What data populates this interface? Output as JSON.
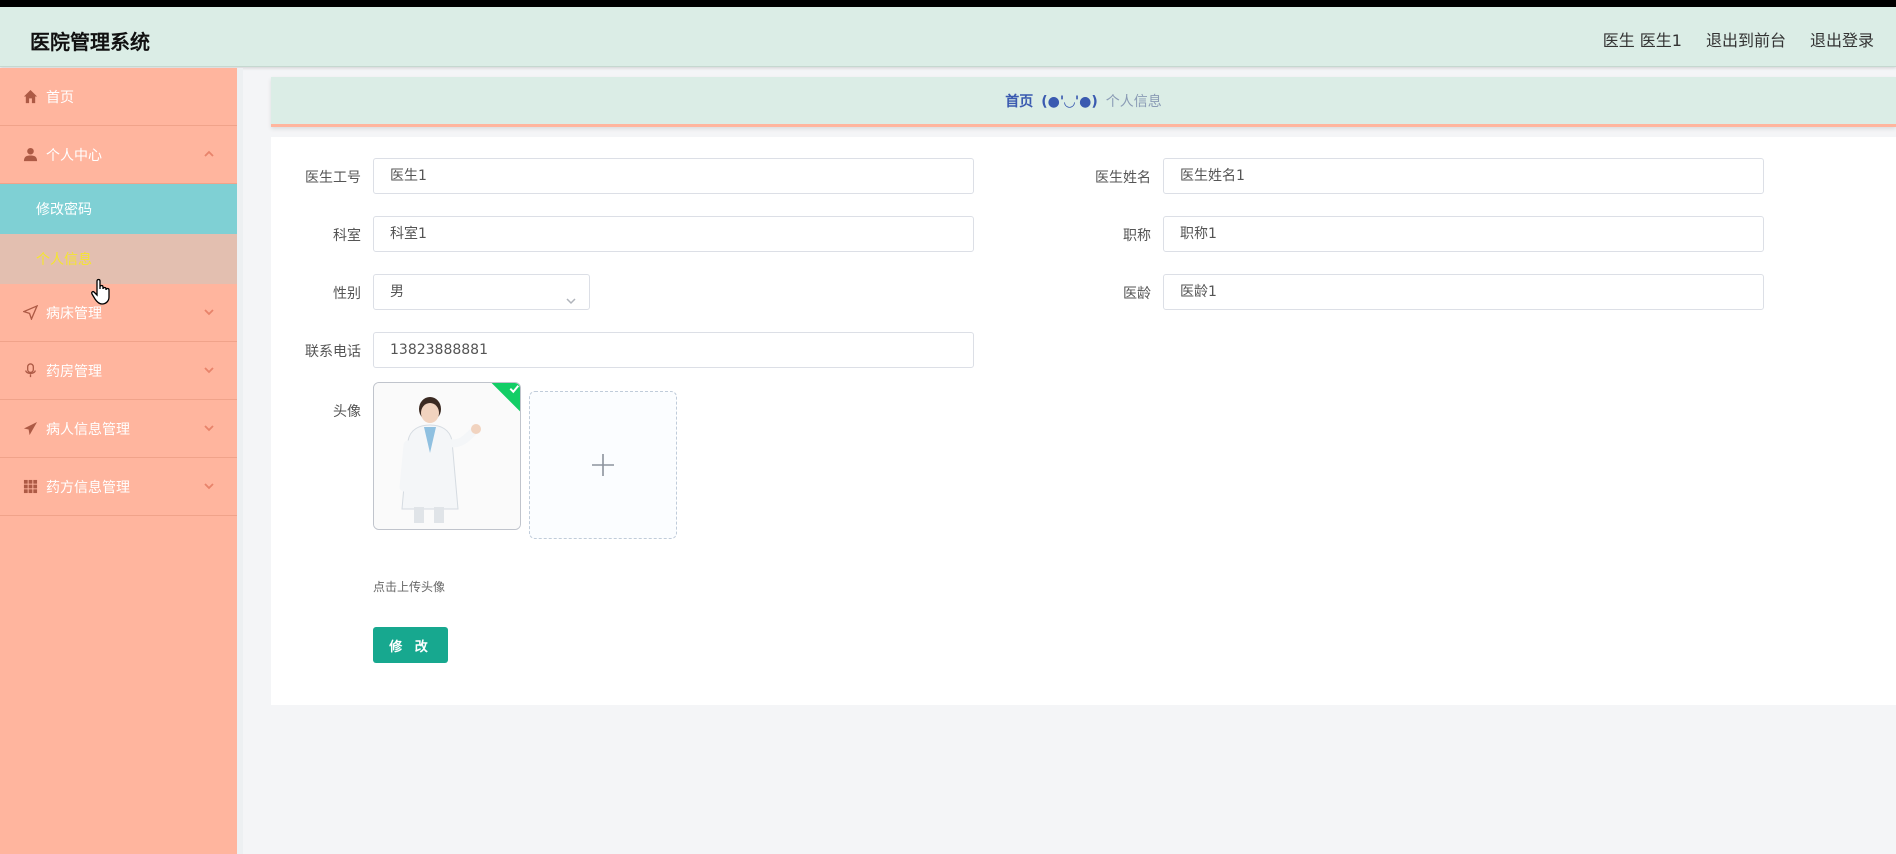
{
  "app": {
    "title": "医院管理系统"
  },
  "header": {
    "user_label": "医生 医生1",
    "to_front_label": "退出到前台",
    "logout_label": "退出登录"
  },
  "sidebar": {
    "items": [
      {
        "label": "首页",
        "icon": "home-icon"
      },
      {
        "label": "个人中心",
        "icon": "user-icon",
        "expanded": true,
        "children": [
          {
            "label": "修改密码"
          },
          {
            "label": "个人信息"
          }
        ]
      },
      {
        "label": "病床管理",
        "icon": "paper-plane-icon"
      },
      {
        "label": "药房管理",
        "icon": "microphone-icon"
      },
      {
        "label": "病人信息管理",
        "icon": "send-icon"
      },
      {
        "label": "药方信息管理",
        "icon": "grid-icon"
      }
    ]
  },
  "breadcrumb": {
    "home": "首页",
    "separator": "(●'◡'●)",
    "current": "个人信息"
  },
  "form": {
    "doctor_id": {
      "label": "医生工号",
      "value": "医生1"
    },
    "doctor_name": {
      "label": "医生姓名",
      "value": "医生姓名1"
    },
    "department": {
      "label": "科室",
      "value": "科室1"
    },
    "title": {
      "label": "职称",
      "value": "职称1"
    },
    "gender": {
      "label": "性别",
      "value": "男"
    },
    "seniority": {
      "label": "医龄",
      "value": "医龄1"
    },
    "phone": {
      "label": "联系电话",
      "value": "13823888881"
    },
    "avatar": {
      "label": "头像",
      "hint": "点击上传头像"
    },
    "submit_label": "修 改"
  },
  "colors": {
    "header_bg": "#dbede6",
    "sidebar_bg": "#ffb59e",
    "active_sub_bg": "#7fd0d4",
    "current_sub_text": "#f5e52f",
    "submit_bg": "#17a88f"
  }
}
